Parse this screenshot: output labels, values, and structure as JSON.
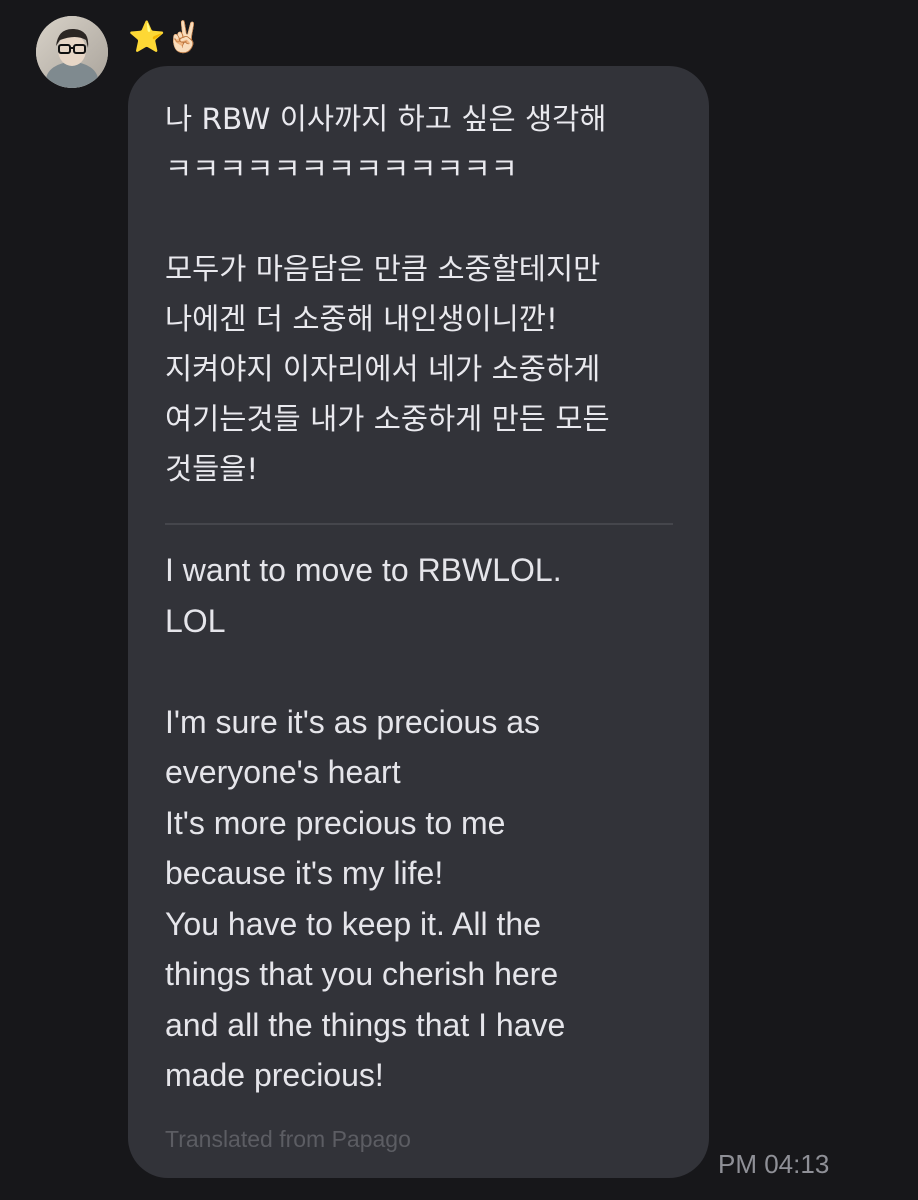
{
  "sender": {
    "avatar_icon": "profile-photo",
    "name": "⭐✌🏻"
  },
  "message": {
    "original_text": "나 RBW 이사까지 하고 싶은 생각해\nㅋㅋㅋㅋㅋㅋㅋㅋㅋㅋㅋㅋㅋ\n\n모두가 마음담은 만큼 소중할테지만\n나에겐 더 소중해 내인생이니깐!\n지켜야지 이자리에서 네가 소중하게\n여기는것들 내가 소중하게 만든 모든\n것들을!",
    "translated_text": "I want to move to RBWLOL.\nLOL\n\nI'm sure it's as precious as\neveryone's heart\nIt's more precious to me\nbecause it's my life!\nYou have to keep it. All the\nthings that you cherish here\nand all the things that I have\nmade precious!",
    "translation_credit": "Translated from Papago",
    "timestamp": "PM 04:13"
  },
  "colors": {
    "background": "#17171a",
    "bubble": "#323339",
    "text": "#e9e9ee",
    "muted": "#5c5d63",
    "timestamp": "#8f9097"
  }
}
